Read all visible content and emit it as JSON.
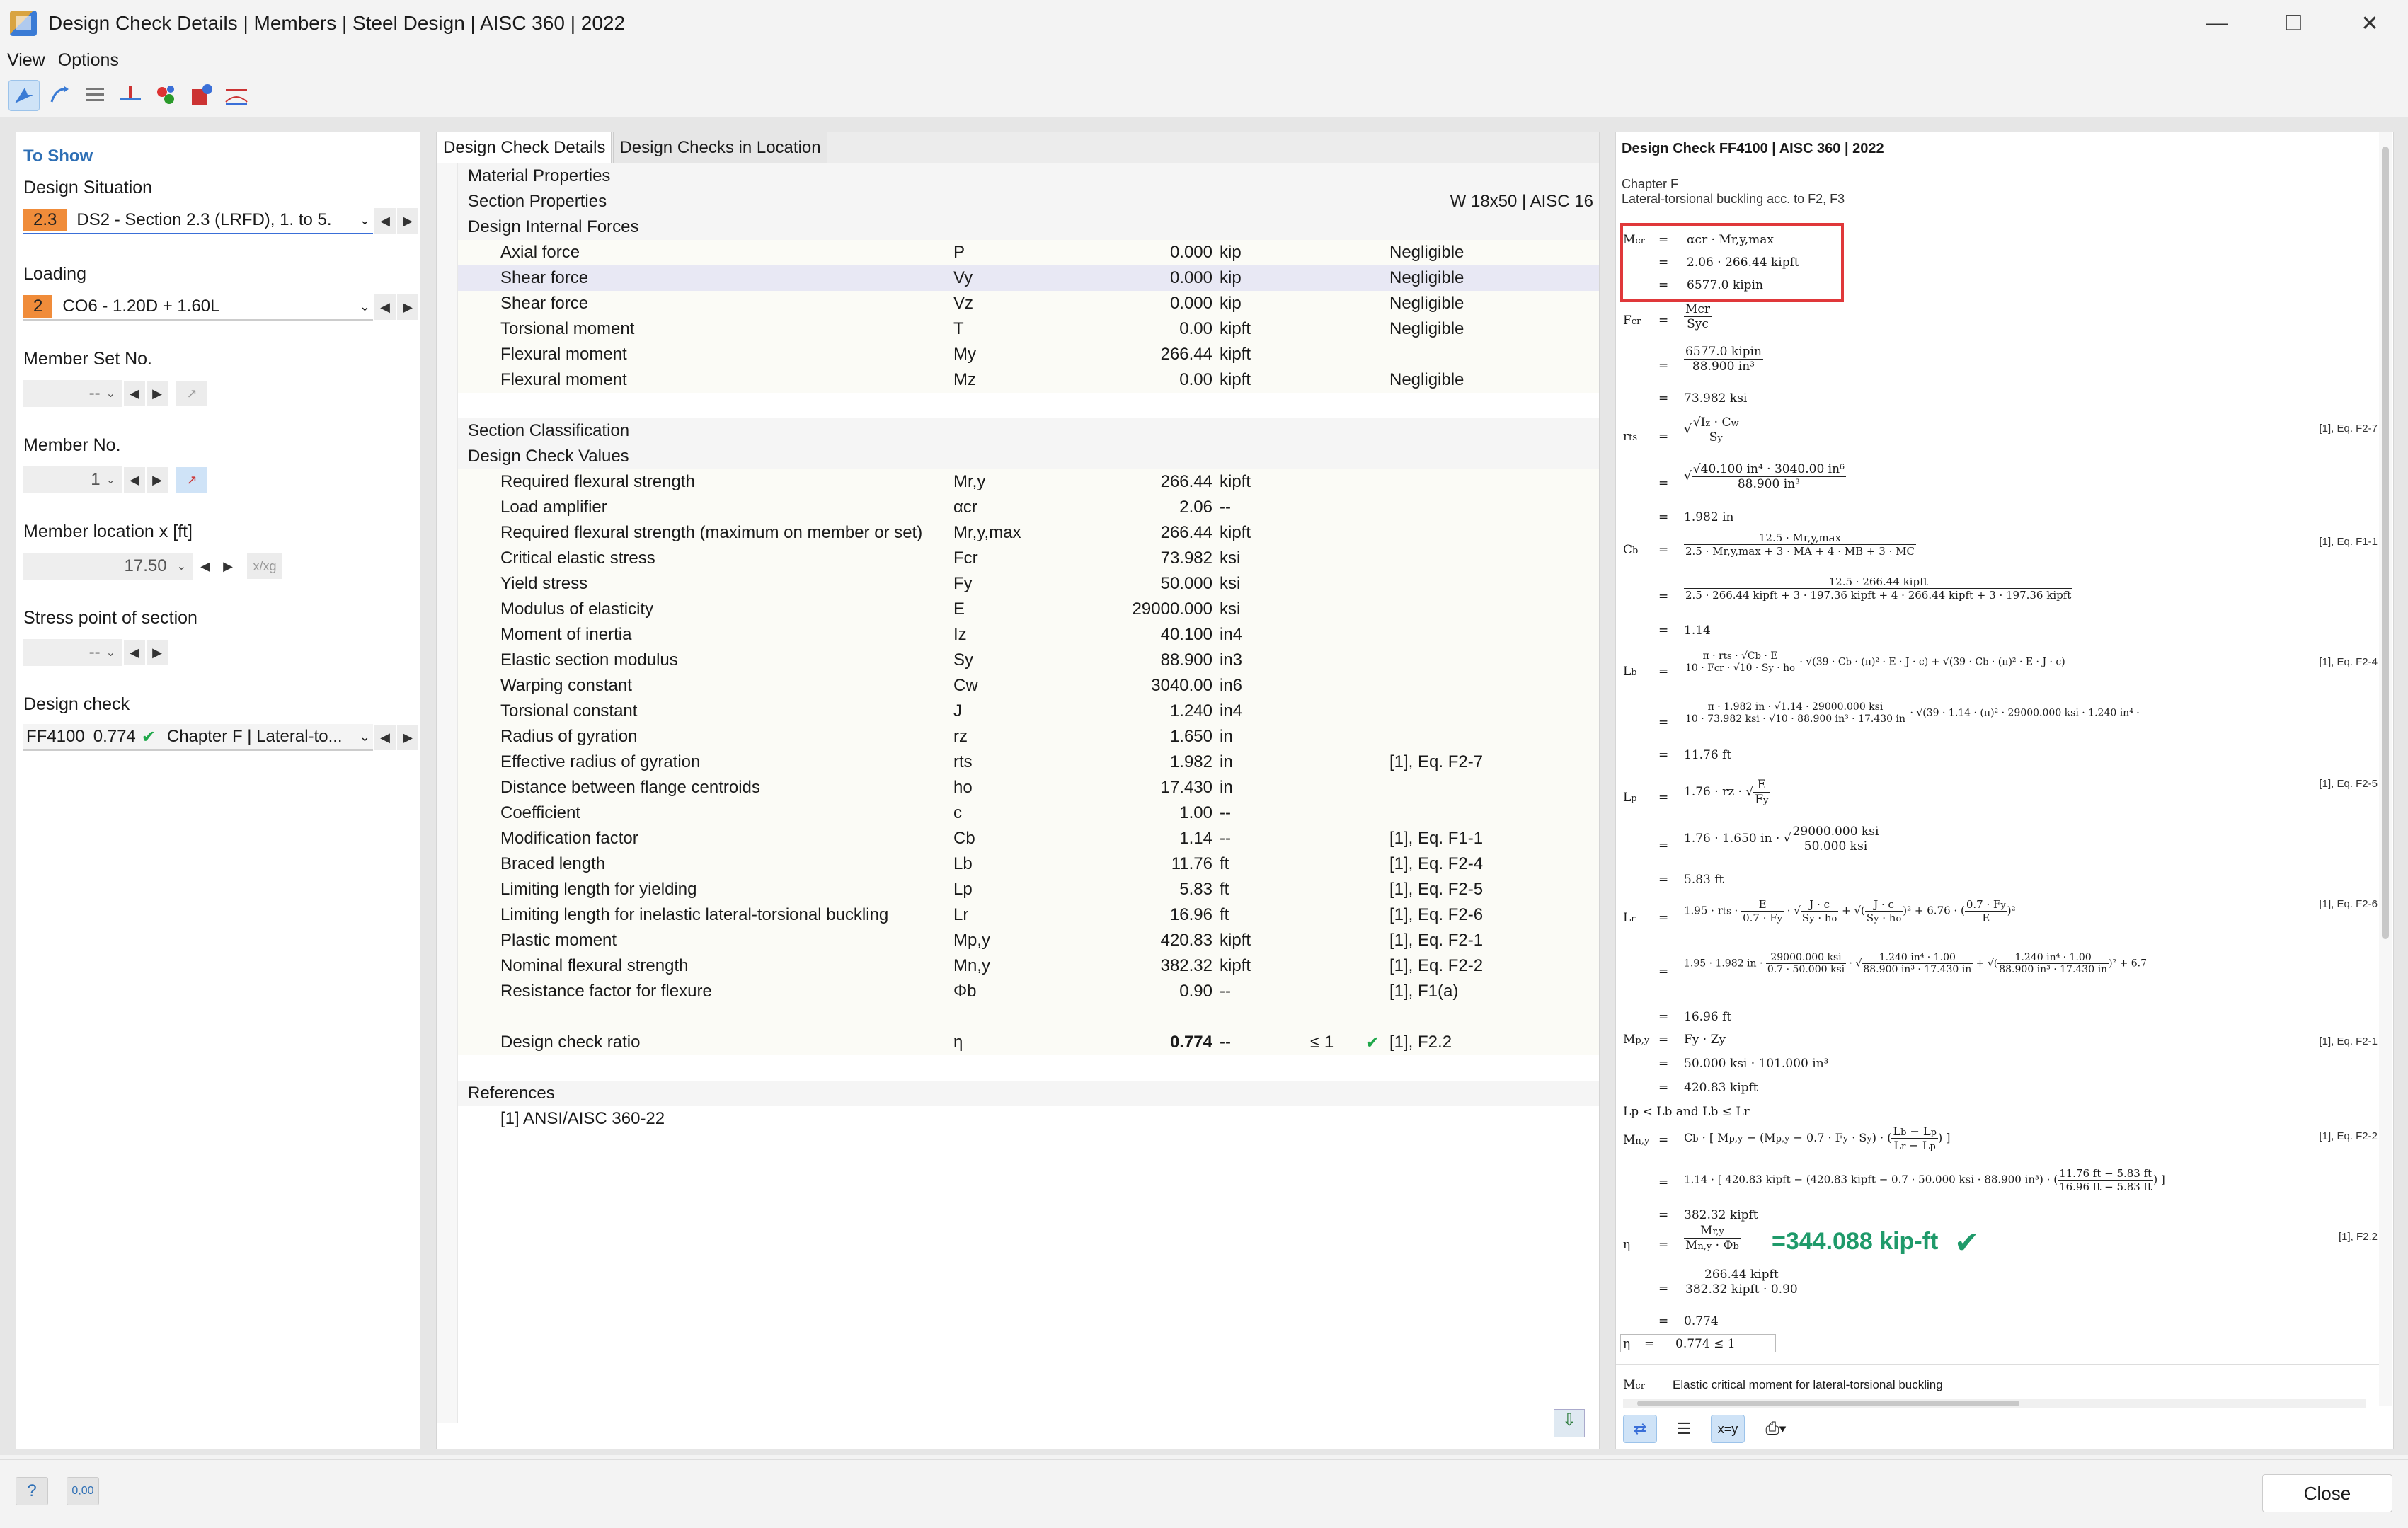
{
  "window": {
    "title": "Design Check Details | Members | Steel Design | AISC 360 | 2022"
  },
  "menu": [
    "View",
    "Options"
  ],
  "left": {
    "title": "To Show",
    "design_situation": {
      "label": "Design Situation",
      "badge": "2.3",
      "value": "DS2 - Section 2.3 (LRFD), 1. to 5."
    },
    "loading": {
      "label": "Loading",
      "badge": "2",
      "value": "CO6 - 1.20D + 1.60L"
    },
    "member_set": {
      "label": "Member Set No.",
      "value": "--"
    },
    "member_no": {
      "label": "Member No.",
      "value": "1"
    },
    "location": {
      "label": "Member location x [ft]",
      "value": "17.50",
      "btn": "x/xg"
    },
    "stress_point": {
      "label": "Stress point of section",
      "value": "--"
    },
    "design_check": {
      "label": "Design check",
      "id": "FF4100",
      "ratio": "0.774",
      "value": "Chapter F | Lateral-to..."
    }
  },
  "tabs": [
    "Design Check Details",
    "Design Checks in Location"
  ],
  "tree": {
    "sections": {
      "material": "Material Properties",
      "section_props": "Section Properties",
      "section_value": "W 18x50 | AISC 16",
      "internal": "Design Internal Forces",
      "classification": "Section Classification",
      "check_values": "Design Check Values",
      "references": "References"
    },
    "forces": [
      {
        "name": "Axial force",
        "sym": "P",
        "val": "0.000",
        "unit": "kip",
        "note": "Negligible"
      },
      {
        "name": "Shear force",
        "sym": "Vy",
        "val": "0.000",
        "unit": "kip",
        "note": "Negligible"
      },
      {
        "name": "Shear force",
        "sym": "Vz",
        "val": "0.000",
        "unit": "kip",
        "note": "Negligible"
      },
      {
        "name": "Torsional moment",
        "sym": "T",
        "val": "0.00",
        "unit": "kipft",
        "note": "Negligible"
      },
      {
        "name": "Flexural moment",
        "sym": "My",
        "val": "266.44",
        "unit": "kipft",
        "note": ""
      },
      {
        "name": "Flexural moment",
        "sym": "Mz",
        "val": "0.00",
        "unit": "kipft",
        "note": "Negligible"
      }
    ],
    "values": [
      {
        "name": "Required flexural strength",
        "sym": "Mr,y",
        "val": "266.44",
        "unit": "kipft",
        "ref": ""
      },
      {
        "name": "Load amplifier",
        "sym": "αcr",
        "val": "2.06",
        "unit": "--",
        "ref": ""
      },
      {
        "name": "Required flexural strength (maximum on member or set)",
        "sym": "Mr,y,max",
        "val": "266.44",
        "unit": "kipft",
        "ref": ""
      },
      {
        "name": "Critical elastic stress",
        "sym": "Fcr",
        "val": "73.982",
        "unit": "ksi",
        "ref": ""
      },
      {
        "name": "Yield stress",
        "sym": "Fy",
        "val": "50.000",
        "unit": "ksi",
        "ref": ""
      },
      {
        "name": "Modulus of elasticity",
        "sym": "E",
        "val": "29000.000",
        "unit": "ksi",
        "ref": ""
      },
      {
        "name": "Moment of inertia",
        "sym": "Iz",
        "val": "40.100",
        "unit": "in4",
        "ref": ""
      },
      {
        "name": "Elastic section modulus",
        "sym": "Sy",
        "val": "88.900",
        "unit": "in3",
        "ref": ""
      },
      {
        "name": "Warping constant",
        "sym": "Cw",
        "val": "3040.00",
        "unit": "in6",
        "ref": ""
      },
      {
        "name": "Torsional constant",
        "sym": "J",
        "val": "1.240",
        "unit": "in4",
        "ref": ""
      },
      {
        "name": "Radius of gyration",
        "sym": "rz",
        "val": "1.650",
        "unit": "in",
        "ref": ""
      },
      {
        "name": "Effective radius of gyration",
        "sym": "rts",
        "val": "1.982",
        "unit": "in",
        "ref": "[1], Eq. F2-7"
      },
      {
        "name": "Distance between flange centroids",
        "sym": "ho",
        "val": "17.430",
        "unit": "in",
        "ref": ""
      },
      {
        "name": "Coefficient",
        "sym": "c",
        "val": "1.00",
        "unit": "--",
        "ref": ""
      },
      {
        "name": "Modification factor",
        "sym": "Cb",
        "val": "1.14",
        "unit": "--",
        "ref": "[1], Eq. F1-1"
      },
      {
        "name": "Braced length",
        "sym": "Lb",
        "val": "11.76",
        "unit": "ft",
        "ref": "[1], Eq. F2-4"
      },
      {
        "name": "Limiting length for yielding",
        "sym": "Lp",
        "val": "5.83",
        "unit": "ft",
        "ref": "[1], Eq. F2-5"
      },
      {
        "name": "Limiting length for inelastic lateral-torsional buckling",
        "sym": "Lr",
        "val": "16.96",
        "unit": "ft",
        "ref": "[1], Eq. F2-6"
      },
      {
        "name": "Plastic moment",
        "sym": "Mp,y",
        "val": "420.83",
        "unit": "kipft",
        "ref": "[1], Eq. F2-1"
      },
      {
        "name": "Nominal flexural strength",
        "sym": "Mn,y",
        "val": "382.32",
        "unit": "kipft",
        "ref": "[1], Eq. F2-2"
      },
      {
        "name": "Resistance factor for flexure",
        "sym": "Φb",
        "val": "0.90",
        "unit": "--",
        "ref": "[1], F1(a)"
      }
    ],
    "ratio": {
      "name": "Design check ratio",
      "sym": "η",
      "val": "0.774",
      "unit": "--",
      "le": "≤ 1",
      "ref": "[1], F2.2"
    },
    "reference_item": "[1]  ANSI/AISC 360-22"
  },
  "right": {
    "heading": "Design Check FF4100 | AISC 360 | 2022",
    "chapter": "Chapter F",
    "desc": "Lateral-torsional buckling acc. to F2, F3",
    "mcr": {
      "l1": "αcr · Mr,y,max",
      "l2": "2.06 · 266.44 kipft",
      "l3": "6577.0 kipin"
    },
    "fcr": {
      "num": "Mcr",
      "den": "Syc",
      "n2": "6577.0 kipin",
      "d2": "88.900 in³",
      "res": "73.982 ksi"
    },
    "rts": {
      "n2": "√40.100 in⁴ · 3040.00 in⁶",
      "d2": "88.900 in³",
      "res": "1.982 in",
      "ref": "[1], Eq. F2-7"
    },
    "cb": {
      "num": "12.5 · Mr,y,max",
      "den": "2.5 · Mr,y,max + 3 · MA + 4 · MB + 3 · MC",
      "n2": "12.5 · 266.44 kipft",
      "d2": "2.5 · 266.44 kipft + 3 · 197.36 kipft + 4 · 266.44 kipft + 3 · 197.36 kipft",
      "res": "1.14",
      "ref": "[1], Eq. F1-1"
    },
    "lb": {
      "res": "11.76 ft",
      "ref": "[1], Eq. F2-4"
    },
    "lp": {
      "l1": "1.76 · rz ·",
      "l2": "1.76 · 1.650 in ·",
      "n2": "29000.000 ksi",
      "d2": "50.000 ksi",
      "res": "5.83 ft",
      "ref": "[1], Eq. F2-5"
    },
    "lr": {
      "res": "16.96 ft",
      "ref": "[1], Eq. F2-6"
    },
    "mp": {
      "l1": "Fy · Zy",
      "l2": "50.000 ksi · 101.000 in³",
      "l3": "420.83 kipft",
      "ref": "[1], Eq. F2-1"
    },
    "cond": "Lp < Lb and Lb ≤ Lr",
    "mn": {
      "res": "382.32 kipft",
      "ref": "[1], Eq. F2-2"
    },
    "eta": {
      "n2": "266.44 kipft",
      "d2": "382.32 kipft · 0.90",
      "res": "0.774",
      "ref": "[1], F2.2",
      "final": "0.774 ≤ 1"
    },
    "annotation": "=344.088 kip-ft",
    "legend": {
      "sym": "Mcr",
      "text": "Elastic critical moment for lateral-torsional buckling"
    }
  },
  "footer": {
    "close": "Close"
  },
  "colors": {
    "accent": "#2e6fb5",
    "badge": "#f08c3a",
    "check": "#1fa84a",
    "highlight": "#e0383a"
  }
}
